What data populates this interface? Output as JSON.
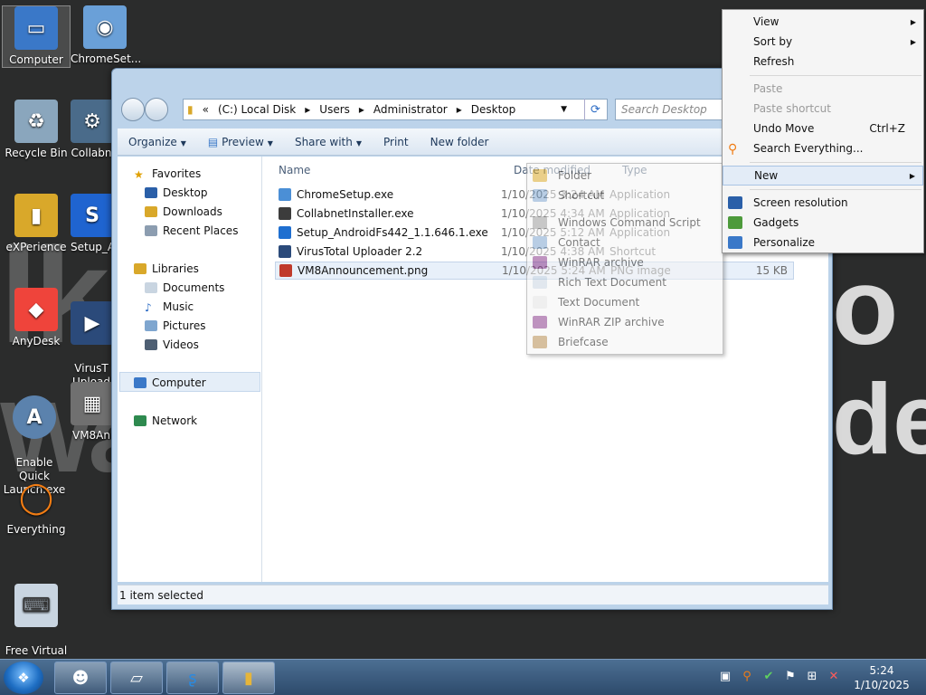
{
  "desktop": {
    "icons": [
      {
        "label": "Computer",
        "icon": "computer-icon",
        "color": "#3a78c8"
      },
      {
        "label": "ChromeSet...",
        "icon": "chrome-setup-icon",
        "color": "#6aa0d8"
      },
      {
        "label": "Recycle Bin",
        "icon": "recycle-bin-icon",
        "color": "#8aa6bd"
      },
      {
        "label": "Collabn",
        "icon": "collabnet-icon",
        "color": "#4a6b8a"
      },
      {
        "label": "eXPerience",
        "icon": "folder-icon",
        "color": "#d9a82a"
      },
      {
        "label": "Setup_A",
        "icon": "setup-android-icon",
        "color": "#1f64d0"
      },
      {
        "label": "AnyDesk",
        "icon": "anydesk-icon",
        "color": "#ef443b"
      },
      {
        "label": "VirusT\nUpload",
        "icon": "virustotal-icon",
        "color": "#2b4a7a"
      },
      {
        "label": "Enable Quick\nLaunch.exe",
        "icon": "quick-launch-icon",
        "color": "#5b82ad"
      },
      {
        "label": "VM8An",
        "icon": "image-file-icon",
        "color": "#707070"
      },
      {
        "label": "Everything",
        "icon": "everything-icon",
        "color": "#f07c14"
      },
      {
        "label": "Free Virtual\nKeyboard",
        "icon": "keyboard-icon",
        "color": "#c9d5e1"
      }
    ]
  },
  "explorer": {
    "address": {
      "chevrons": "«",
      "segments": [
        "(C:) Local Disk",
        "Users",
        "Administrator",
        "Desktop"
      ]
    },
    "search_placeholder": "Search Desktop",
    "toolbar": [
      {
        "label": "Organize",
        "caret": "▼"
      },
      {
        "label": "Preview",
        "caret": "▼"
      },
      {
        "label": "Share with",
        "caret": "▼"
      },
      {
        "label": "Print",
        "caret": ""
      },
      {
        "label": "New folder",
        "caret": ""
      }
    ],
    "nav": {
      "favorites": "Favorites",
      "desktop": "Desktop",
      "downloads": "Downloads",
      "recent": "Recent Places",
      "libraries": "Libraries",
      "documents": "Documents",
      "music": "Music",
      "pictures": "Pictures",
      "videos": "Videos",
      "computer": "Computer",
      "network": "Network"
    },
    "columns": {
      "name": "Name",
      "date": "Date modified",
      "type": "Type"
    },
    "files": [
      {
        "name": "ChromeSetup.exe",
        "date": "1/10/2025 3:24 AM",
        "type": "Application",
        "size": "",
        "color": "#4b8fd6"
      },
      {
        "name": "CollabnetInstaller.exe",
        "date": "1/10/2025 4:34 AM",
        "type": "Application",
        "size": "",
        "color": "#3c3c3c"
      },
      {
        "name": "Setup_AndroidFs442_1.1.646.1.exe",
        "date": "1/10/2025 5:12 AM",
        "type": "Application",
        "size": "",
        "color": "#1f6fd0"
      },
      {
        "name": "VirusTotal Uploader 2.2",
        "date": "1/10/2025 4:38 AM",
        "type": "Shortcut",
        "size": "",
        "color": "#2b4a7a"
      },
      {
        "name": "VM8Announcement.png",
        "date": "1/10/2025 5:24 AM",
        "type": "PNG image",
        "size": "15 KB",
        "color": "#c03a2b"
      }
    ],
    "status": "1 item selected"
  },
  "context_menu": {
    "items": [
      {
        "label": "View",
        "arrow": "▶",
        "enabled": true
      },
      {
        "label": "Sort by",
        "arrow": "▶",
        "enabled": true
      },
      {
        "label": "Refresh",
        "enabled": true
      },
      {
        "label": "Paste",
        "enabled": false
      },
      {
        "label": "Paste shortcut",
        "enabled": false
      },
      {
        "label": "Undo Move",
        "shortcut": "Ctrl+Z",
        "enabled": true
      },
      {
        "label": "Search Everything...",
        "enabled": true
      },
      {
        "label": "New",
        "arrow": "▶",
        "enabled": true
      },
      {
        "label": "Screen resolution",
        "enabled": true
      },
      {
        "label": "Gadgets",
        "enabled": true
      },
      {
        "label": "Personalize",
        "enabled": true
      }
    ]
  },
  "new_submenu": {
    "items": [
      "Folder",
      "Shortcut",
      "Windows Command Script",
      "Contact",
      "WinRAR archive",
      "Rich Text Document",
      "Text Document",
      "WinRAR ZIP archive",
      "Briefcase"
    ]
  },
  "taskbar": {
    "clock_time": "5:24",
    "clock_date": "1/10/2025"
  }
}
